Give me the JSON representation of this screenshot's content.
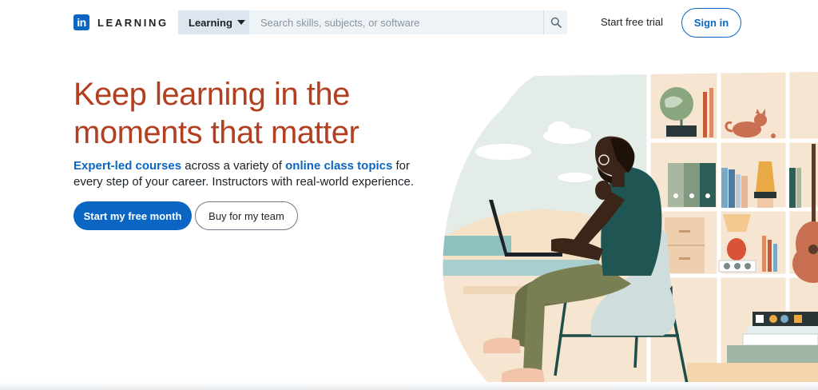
{
  "header": {
    "logo_mark": "in",
    "logo_text": "LEARNING",
    "search": {
      "category": "Learning",
      "placeholder": "Search skills, subjects, or software"
    },
    "trial_link": "Start free trial",
    "signin": "Sign in"
  },
  "hero": {
    "title": "Keep learning in the moments that matter",
    "subtitle": {
      "link1": "Expert-led courses",
      "text1": " across a variety of ",
      "link2": "online class topics",
      "text2": " for every step of your career. Instructors with real-world experience."
    },
    "primary_button": "Start my free month",
    "secondary_button": "Buy for my team"
  },
  "illustration": {
    "subject": "person-with-laptop-on-chair",
    "colors": {
      "sky": "#e3ece6",
      "cream": "#f6e6d1",
      "teal": "#1f4d4a",
      "sea": "#8fc0c0"
    }
  },
  "colors": {
    "brand_blue": "#0a66c2",
    "title_red": "#b24020"
  }
}
